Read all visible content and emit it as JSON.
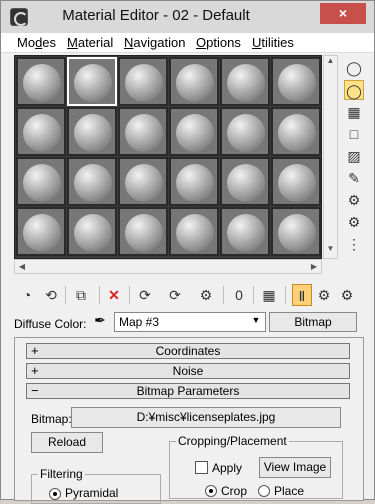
{
  "window": {
    "title": "Material Editor - 02 - Default",
    "close_label": "×"
  },
  "menu": [
    {
      "pre": "Mo",
      "key": "d",
      "post": "es"
    },
    {
      "pre": "",
      "key": "M",
      "post": "aterial"
    },
    {
      "pre": "",
      "key": "N",
      "post": "avigation"
    },
    {
      "pre": "",
      "key": "O",
      "post": "ptions"
    },
    {
      "pre": "",
      "key": "U",
      "post": "tilities"
    }
  ],
  "slots": {
    "rows": 4,
    "cols": 6,
    "active_index": 1
  },
  "right_toolbar": [
    {
      "name": "sample-type-icon",
      "glyph": "◯",
      "on": false
    },
    {
      "name": "backlight-icon",
      "glyph": "◯",
      "on": true
    },
    {
      "name": "background-icon",
      "glyph": "▦",
      "on": false
    },
    {
      "name": "sample-uv-tiling-icon",
      "glyph": "□",
      "on": false
    },
    {
      "name": "video-color-check-icon",
      "glyph": "▨",
      "on": false
    },
    {
      "name": "make-preview-icon",
      "glyph": "✎",
      "on": false
    },
    {
      "name": "options-icon",
      "glyph": "⚙",
      "on": false
    },
    {
      "name": "select-by-material-icon",
      "glyph": "⚙",
      "on": false
    },
    {
      "name": "material-map-navigator-icon",
      "glyph": "⋮",
      "on": false
    }
  ],
  "bottom_toolbar": [
    {
      "name": "get-material-icon",
      "glyph": "◔",
      "kind": ""
    },
    {
      "name": "put-to-scene-icon",
      "glyph": "⟲",
      "kind": ""
    },
    {
      "name": "assign-to-selection-icon",
      "glyph": "⧉",
      "kind": ""
    },
    {
      "name": "reset-map-icon",
      "glyph": "✕",
      "kind": "red"
    },
    {
      "name": "make-copy-icon",
      "glyph": "⟳",
      "kind": ""
    },
    {
      "name": "make-unique-icon",
      "glyph": "⟳",
      "kind": ""
    },
    {
      "name": "put-to-library-icon",
      "glyph": "⚙",
      "kind": ""
    },
    {
      "name": "material-id-channel-icon",
      "glyph": "0",
      "kind": ""
    },
    {
      "name": "show-shaded-material-icon",
      "glyph": "▦",
      "kind": ""
    },
    {
      "name": "show-end-result-icon",
      "glyph": "Ⅱ",
      "kind": "on"
    },
    {
      "name": "go-to-parent-icon",
      "glyph": "⚙",
      "kind": ""
    },
    {
      "name": "go-forward-to-sibling-icon",
      "glyph": "⚙",
      "kind": ""
    }
  ],
  "diffuse": {
    "label": "Diffuse Color:",
    "map_name": "Map #3",
    "map_type": "Bitmap"
  },
  "rollouts": {
    "coordinates": {
      "sign": "+",
      "title": "Coordinates"
    },
    "noise": {
      "sign": "+",
      "title": "Noise"
    },
    "bitmap_parameters": {
      "sign": "−",
      "title": "Bitmap Parameters"
    }
  },
  "bitmap": {
    "label": "Bitmap:",
    "path": "D:¥misc¥licenseplates.jpg",
    "reload_label": "Reload"
  },
  "cropping": {
    "title": "Cropping/Placement",
    "apply_label": "Apply",
    "view_image_label": "View Image",
    "crop_label": "Crop",
    "place_label": "Place",
    "mode": "Crop"
  },
  "filtering": {
    "title": "Filtering",
    "pyramidal_label": "Pyramidal",
    "selected": "Pyramidal"
  }
}
